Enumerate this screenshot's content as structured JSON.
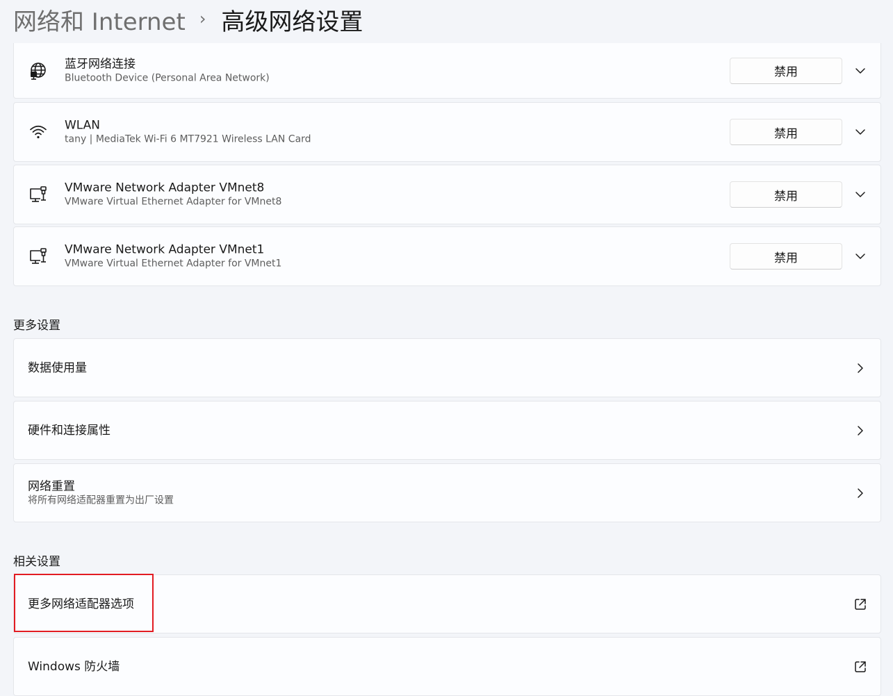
{
  "header": {
    "parent": "网络和 Internet",
    "separator": "›",
    "current": "高级网络设置"
  },
  "adapters": [
    {
      "name": "蓝牙网络连接",
      "description": "Bluetooth Device (Personal Area Network)",
      "icon": "bluetooth-network-icon",
      "button_label": "禁用"
    },
    {
      "name": "WLAN",
      "description": "tany | MediaTek Wi-Fi 6 MT7921 Wireless LAN Card",
      "icon": "wifi-icon",
      "button_label": "禁用"
    },
    {
      "name": "VMware Network Adapter VMnet8",
      "description": "VMware Virtual Ethernet Adapter for VMnet8",
      "icon": "ethernet-adapter-icon",
      "button_label": "禁用"
    },
    {
      "name": "VMware Network Adapter VMnet1",
      "description": "VMware Virtual Ethernet Adapter for VMnet1",
      "icon": "ethernet-adapter-icon",
      "button_label": "禁用"
    }
  ],
  "more_settings": {
    "label": "更多设置",
    "items": [
      {
        "title": "数据使用量"
      },
      {
        "title": "硬件和连接属性"
      },
      {
        "title": "网络重置",
        "subtitle": "将所有网络适配器重置为出厂设置"
      }
    ]
  },
  "related_settings": {
    "label": "相关设置",
    "items": [
      {
        "title": "更多网络适配器选项",
        "highlighted": true
      },
      {
        "title": "Windows 防火墙"
      }
    ]
  },
  "colors": {
    "background": "#f3f5f9",
    "card": "#fcfdff",
    "highlight": "#e21b22"
  }
}
